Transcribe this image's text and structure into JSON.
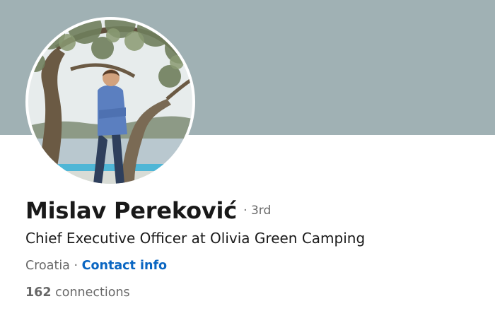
{
  "profile": {
    "name": "Mislav Pereković",
    "separator": "·",
    "degree": "3rd",
    "headline": "Chief Executive Officer at Olivia Green Camping",
    "location": "Croatia",
    "location_separator": "·",
    "contact_label": "Contact info",
    "connections_count": "162",
    "connections_label": "connections"
  },
  "colors": {
    "banner": "#a0b1b4",
    "link": "#0a66c2",
    "text_primary": "#000000e6",
    "text_secondary": "#00000099"
  },
  "icons": {
    "avatar": "profile-photo"
  }
}
